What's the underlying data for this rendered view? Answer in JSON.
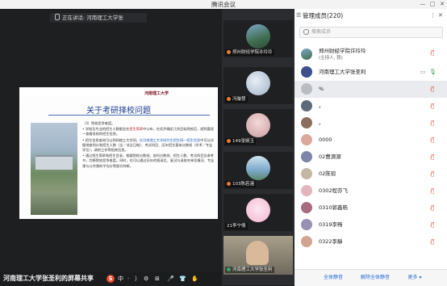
{
  "app": {
    "title": "腾讯会议",
    "window_controls": [
      "—",
      "□",
      "✕"
    ]
  },
  "speaker": {
    "label": "正在讲话: 河南理工大学张"
  },
  "slide": {
    "logo_text": "河南理工大学",
    "title": "关于考研择校问题",
    "paragraphs": [
      {
        "prefix": "（3）",
        "text": "院校竞争难度。"
      },
      {
        "prefix": "",
        "text": "学校及专业的招生人数都会在",
        "hl": "招生简章",
        "text2": "中公布，在初步确定几所目标院校后，就到要逐一查看各校的招生信息。"
      },
      {
        "prefix": "",
        "text": "招生信息查询可以到网络工大学网，",
        "bl": "在河南理工大学研究生招生网—招生信息",
        "text2": "中可以详细地查到计划招生人数（全／非全日制）、考试科目、历年招生基本分数线（学术／专业学位），调剂工作等相关信息。"
      },
      {
        "prefix": "",
        "text": "通过招生简章和招生目录，根据院校分数线、各科分数线、招生人数、考试科目及参考书，判断院校竞争难度。同时，也可以通过历年的报录比、复试与录取名单及情况、专业课与公共课的平均分等细节判断。"
      }
    ]
  },
  "share_bar": {
    "label": "河南理工大学张圣利的屏幕共享",
    "ime_logo": "S",
    "ime_items": [
      "中",
      "·",
      "）",
      "⚙",
      "⊞",
      "🎤",
      "👕",
      "✋"
    ]
  },
  "video_tiles": [
    {
      "name": "郑州财经学院许玲玲",
      "muted": true
    },
    {
      "name": "冯璇慧",
      "muted": true
    },
    {
      "name": "149张婉玉",
      "muted": true
    },
    {
      "name": "103陈若涵",
      "muted": true
    },
    {
      "name": "21李宁倩",
      "muted": false
    },
    {
      "name": "河南理工大学张圣利",
      "muted": false
    }
  ],
  "panel": {
    "title": "管理成员(220)",
    "search_placeholder": "搜索成员",
    "members": [
      {
        "name": "郑州财经学院许玲玲",
        "sub": "(主持人, 我)",
        "state": "muted"
      },
      {
        "name": "河南理工大学张圣利",
        "sub": "",
        "state": "speaking"
      },
      {
        "name": "%",
        "sub": "",
        "state": "muted"
      },
      {
        "name": "。",
        "sub": "",
        "state": "muted"
      },
      {
        "name": "。",
        "sub": "",
        "state": "muted"
      },
      {
        "name": "0000",
        "sub": "",
        "state": "muted"
      },
      {
        "name": "02曹源源",
        "sub": "",
        "state": "muted"
      },
      {
        "name": "02陈琅",
        "sub": "",
        "state": "muted"
      },
      {
        "name": "0302程亦飞",
        "sub": "",
        "state": "muted"
      },
      {
        "name": "0310郭鑫皓",
        "sub": "",
        "state": "muted"
      },
      {
        "name": "0319李畅",
        "sub": "",
        "state": "muted"
      },
      {
        "name": "0322李靜",
        "sub": "",
        "state": "muted"
      }
    ],
    "footer": {
      "mute_all": "全体静音",
      "unmute_all": "解除全体静音",
      "more": "更多 ▾"
    }
  },
  "colors": {
    "muted": "#e24a3d",
    "speaking": "#3aa36a",
    "link_blue": "#2b6cd6",
    "slide_title": "#1b3d8f"
  }
}
